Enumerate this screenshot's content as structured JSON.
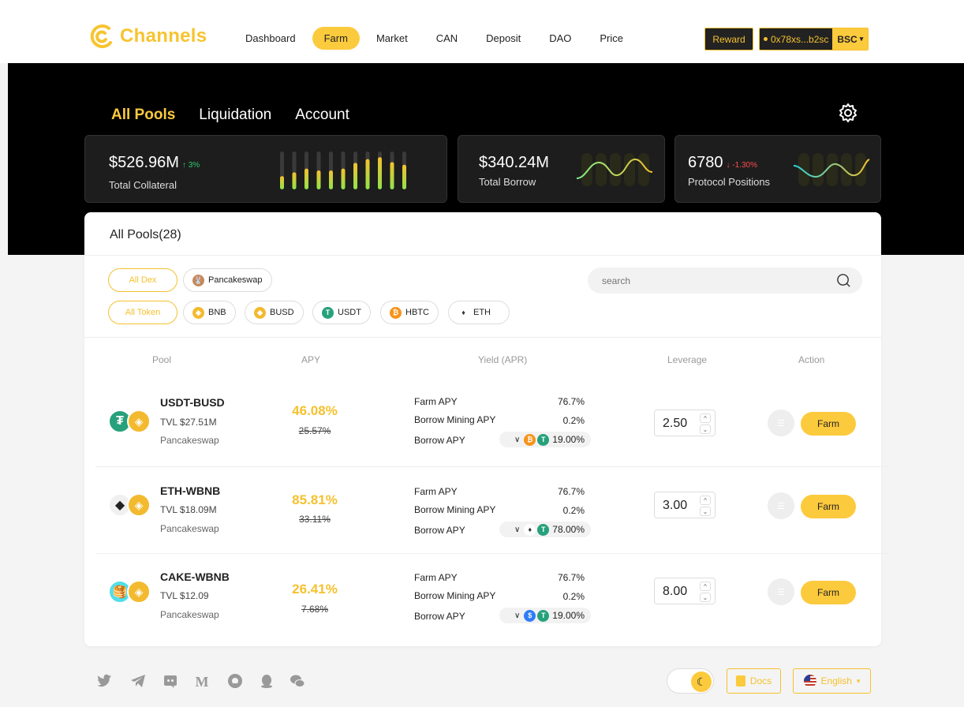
{
  "brand": {
    "name": "Channels",
    "color": "#f7c430"
  },
  "nav": {
    "items": [
      {
        "label": "Dashboard"
      },
      {
        "label": "Farm",
        "active": true
      },
      {
        "label": "Market"
      },
      {
        "label": "CAN"
      },
      {
        "label": "Deposit"
      },
      {
        "label": "DAO"
      },
      {
        "label": "Price"
      }
    ]
  },
  "header": {
    "reward_label": "Reward",
    "wallet_address": "0x78xs...b2sc",
    "chain_label": "BSC"
  },
  "tabs": [
    {
      "label": "All Pools",
      "active": true
    },
    {
      "label": "Liquidation"
    },
    {
      "label": "Account"
    }
  ],
  "stats": {
    "collateral": {
      "value": "$526.96M",
      "change": "↑ 3%",
      "label": "Total Collateral"
    },
    "borrow": {
      "value": "$340.24M",
      "label": "Total Borrow"
    },
    "positions": {
      "value": "6780",
      "change": "↓ -1.30%",
      "label": "Protocol Positions"
    }
  },
  "pools": {
    "title": "All Pools(28)",
    "dex_filters": [
      {
        "label": "All Dex"
      },
      {
        "label": "Pancakeswap",
        "icon": "pancakeswap-icon"
      }
    ],
    "token_filters": [
      {
        "label": "All Token"
      },
      {
        "label": "BNB",
        "icon": "bnb-icon"
      },
      {
        "label": "BUSD",
        "icon": "busd-icon"
      },
      {
        "label": "USDT",
        "icon": "usdt-icon"
      },
      {
        "label": "HBTC",
        "icon": "hbtc-icon"
      },
      {
        "label": "ETH",
        "icon": "eth-icon"
      }
    ],
    "search_placeholder": "search",
    "columns": [
      "Pool",
      "APY",
      "Yield (APR)",
      "Leverage",
      "Action"
    ],
    "rows": [
      {
        "pair": "USDT-BUSD",
        "tvl": "TVL $27.51M",
        "dex": "Pancakeswap",
        "apy": "46.08%",
        "apy_old": "25.57%",
        "farm_apy_label": "Farm APY",
        "farm_apy": "76.7%",
        "mining_label": "Borrow Mining APY",
        "mining_apy": "0.2%",
        "borrow_label": "Borrow APY",
        "borrow_apy": "19.00%",
        "leverage": "2.50",
        "action": "Farm"
      },
      {
        "pair": "ETH-WBNB",
        "tvl": "TVL $18.09M",
        "dex": "Pancakeswap",
        "apy": "85.81%",
        "apy_old": "33.11%",
        "farm_apy_label": "Farm APY",
        "farm_apy": "76.7%",
        "mining_label": "Borrow Mining APY",
        "mining_apy": "0.2%",
        "borrow_label": "Borrow APY",
        "borrow_apy": "78.00%",
        "leverage": "3.00",
        "action": "Farm"
      },
      {
        "pair": "CAKE-WBNB",
        "tvl": "TVL $12.09",
        "dex": "Pancakeswap",
        "apy": "26.41%",
        "apy_old": "7.68%",
        "farm_apy_label": "Farm APY",
        "farm_apy": "76.7%",
        "mining_label": "Borrow Mining APY",
        "mining_apy": "0.2%",
        "borrow_label": "Borrow APY",
        "borrow_apy": "19.00%",
        "leverage": "8.00",
        "action": "Farm"
      }
    ]
  },
  "footer": {
    "social": [
      "twitter-icon",
      "telegram-icon",
      "discord-icon",
      "medium-icon",
      "github-icon",
      "qq-icon",
      "wechat-icon"
    ],
    "docs_label": "Docs",
    "language_label": "English"
  },
  "colors": {
    "accent": "#fcca3d",
    "up": "#2ecc71",
    "down": "#ff4d4f"
  }
}
